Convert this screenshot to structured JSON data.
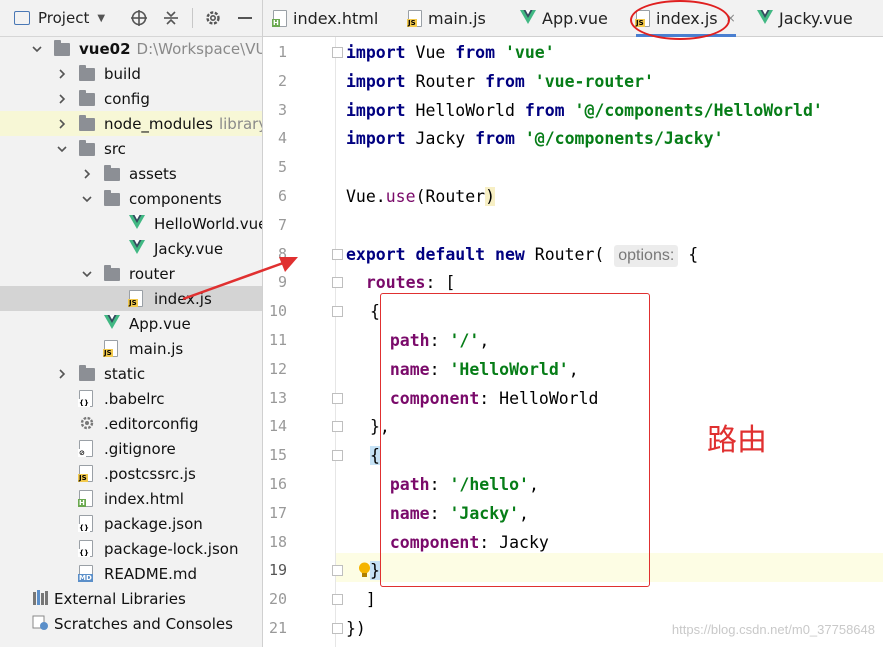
{
  "project_panel": {
    "title": "Project",
    "tree": [
      {
        "label": "vue02",
        "hint": "D:\\Workspace\\VUE_P",
        "type": "folder",
        "expanded": true
      },
      {
        "label": "build",
        "type": "folder"
      },
      {
        "label": "config",
        "type": "folder"
      },
      {
        "label": "node_modules",
        "hint": "library roo",
        "type": "folder"
      },
      {
        "label": "src",
        "type": "folder",
        "expanded": true
      },
      {
        "label": "assets",
        "type": "folder"
      },
      {
        "label": "components",
        "type": "folder",
        "expanded": true
      },
      {
        "label": "HelloWorld.vue",
        "type": "vue"
      },
      {
        "label": "Jacky.vue",
        "type": "vue"
      },
      {
        "label": "router",
        "type": "folder",
        "expanded": true
      },
      {
        "label": "index.js",
        "type": "js",
        "selected": true
      },
      {
        "label": "App.vue",
        "type": "vue"
      },
      {
        "label": "main.js",
        "type": "js"
      },
      {
        "label": "static",
        "type": "folder"
      },
      {
        "label": ".babelrc",
        "type": "config"
      },
      {
        "label": ".editorconfig",
        "type": "gear"
      },
      {
        "label": ".gitignore",
        "type": "ignore"
      },
      {
        "label": ".postcssrc.js",
        "type": "js"
      },
      {
        "label": "index.html",
        "type": "html"
      },
      {
        "label": "package.json",
        "type": "config"
      },
      {
        "label": "package-lock.json",
        "type": "config"
      },
      {
        "label": "README.md",
        "type": "md"
      },
      {
        "label": "External Libraries",
        "type": "libs"
      },
      {
        "label": "Scratches and Consoles",
        "type": "scratch"
      }
    ]
  },
  "tabs": [
    {
      "label": "index.html",
      "icon": "html-file-icon"
    },
    {
      "label": "main.js",
      "icon": "js-file-icon"
    },
    {
      "label": "App.vue",
      "icon": "vue-file-icon"
    },
    {
      "label": "index.js",
      "icon": "js-file-icon",
      "active": true
    },
    {
      "label": "Jacky.vue",
      "icon": "vue-file-icon"
    }
  ],
  "editor": {
    "line_numbers": [
      "1",
      "2",
      "3",
      "4",
      "5",
      "6",
      "7",
      "8",
      "9",
      "10",
      "11",
      "12",
      "13",
      "14",
      "15",
      "16",
      "17",
      "18",
      "19",
      "20",
      "21"
    ],
    "current_line": 19,
    "inlay_hint": "options:",
    "annotation": "路由"
  },
  "watermark": "https://blog.csdn.net/m0_37758648",
  "colors": {
    "annotation": "#e03030",
    "keyword": "#000080",
    "string": "#067d17",
    "property": "#7a0a6a"
  }
}
